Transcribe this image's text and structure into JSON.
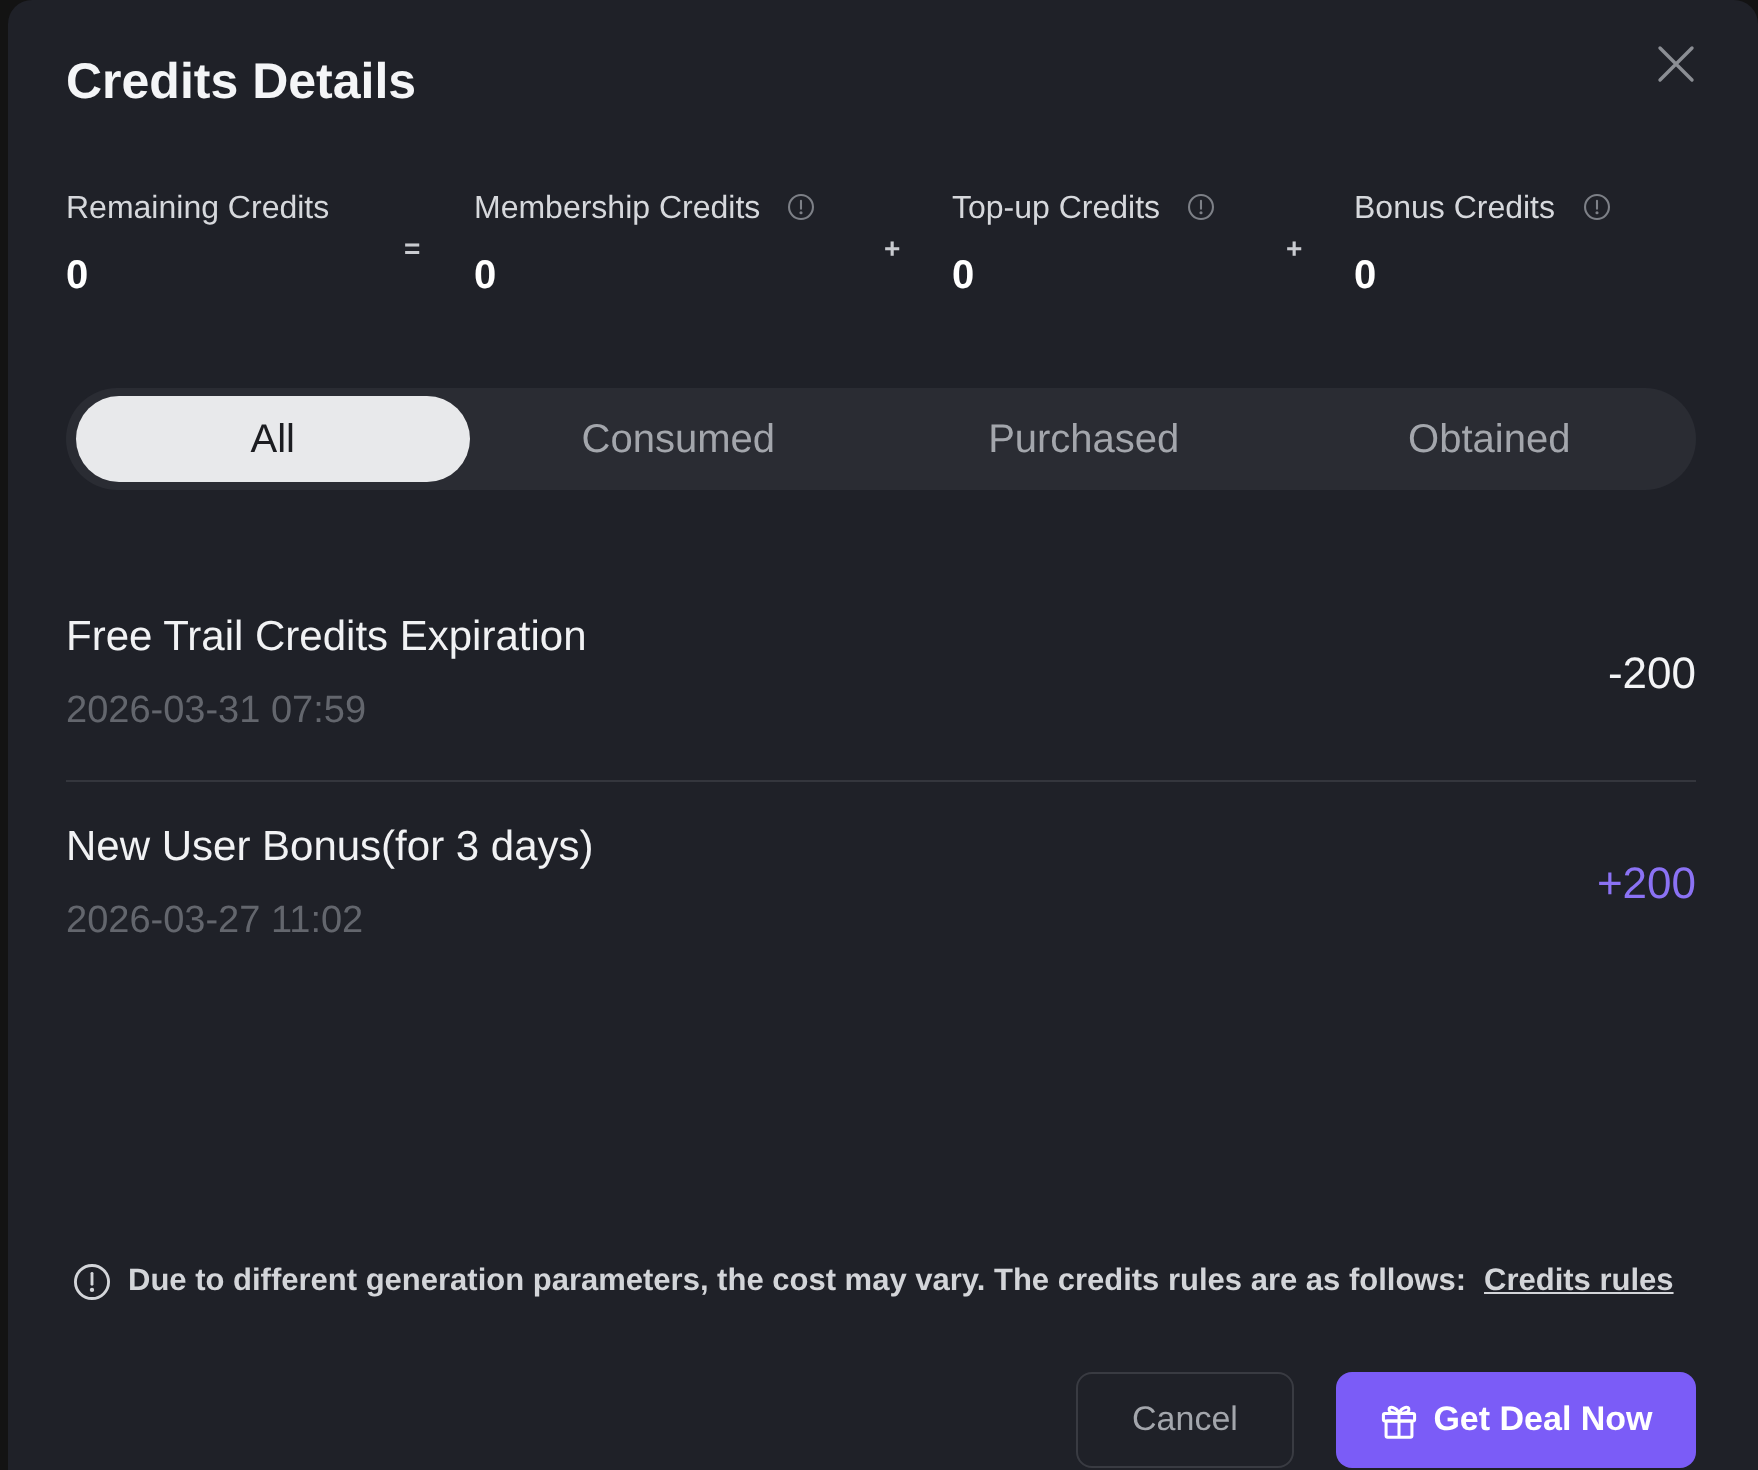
{
  "dialog": {
    "title": "Credits Details"
  },
  "summary": [
    {
      "label": "Remaining Credits",
      "value": "0",
      "info": false
    },
    {
      "label": "Membership Credits",
      "value": "0",
      "info": true
    },
    {
      "label": "Top-up Credits",
      "value": "0",
      "info": true
    },
    {
      "label": "Bonus Credits",
      "value": "0",
      "info": true
    }
  ],
  "operators": [
    "=",
    "+",
    "+"
  ],
  "tabs": [
    {
      "label": "All",
      "selected": true
    },
    {
      "label": "Consumed",
      "selected": false
    },
    {
      "label": "Purchased",
      "selected": false
    },
    {
      "label": "Obtained",
      "selected": false
    }
  ],
  "records": [
    {
      "title": "Free Trail Credits Expiration",
      "date": "2026-03-31 07:59",
      "amount": "-200",
      "kind": "debit"
    },
    {
      "title": "New User Bonus(for 3 days)",
      "date": "2026-03-27 11:02",
      "amount": "+200",
      "kind": "credit"
    }
  ],
  "note": {
    "text": "Due to different generation parameters, the cost may vary. The credits rules are as follows:",
    "link": "Credits rules"
  },
  "buttons": [
    {
      "label": "Cancel",
      "kind": "secondary"
    },
    {
      "label": "Get Deal Now",
      "kind": "primary"
    }
  ]
}
